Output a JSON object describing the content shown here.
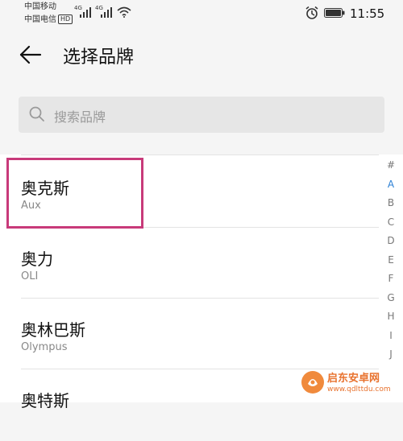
{
  "status_bar": {
    "carrier_1": "中国移动",
    "carrier_2": "中国电信",
    "hd_badge": "HD",
    "network_1": "4G",
    "network_2": "4G",
    "time": "11:55"
  },
  "header": {
    "title": "选择品牌"
  },
  "search": {
    "placeholder": "搜索品牌"
  },
  "brands": [
    {
      "name_zh": "奥克斯",
      "name_en": "Aux",
      "highlighted": true
    },
    {
      "name_zh": "奥力",
      "name_en": "OLI"
    },
    {
      "name_zh": "奥林巴斯",
      "name_en": "Olympus"
    },
    {
      "name_zh": "奥特斯",
      "name_en": ""
    }
  ],
  "index_bar": {
    "letters": [
      "#",
      "A",
      "B",
      "C",
      "D",
      "E",
      "F",
      "G",
      "H",
      "I",
      "J"
    ],
    "active_letter": "A"
  },
  "watermark": {
    "title": "启东安卓网",
    "url": "www.qdlttdu.com"
  },
  "colors": {
    "highlight": "#c83a7a",
    "accent": "#2a7fd4",
    "watermark": "#e8722e"
  }
}
